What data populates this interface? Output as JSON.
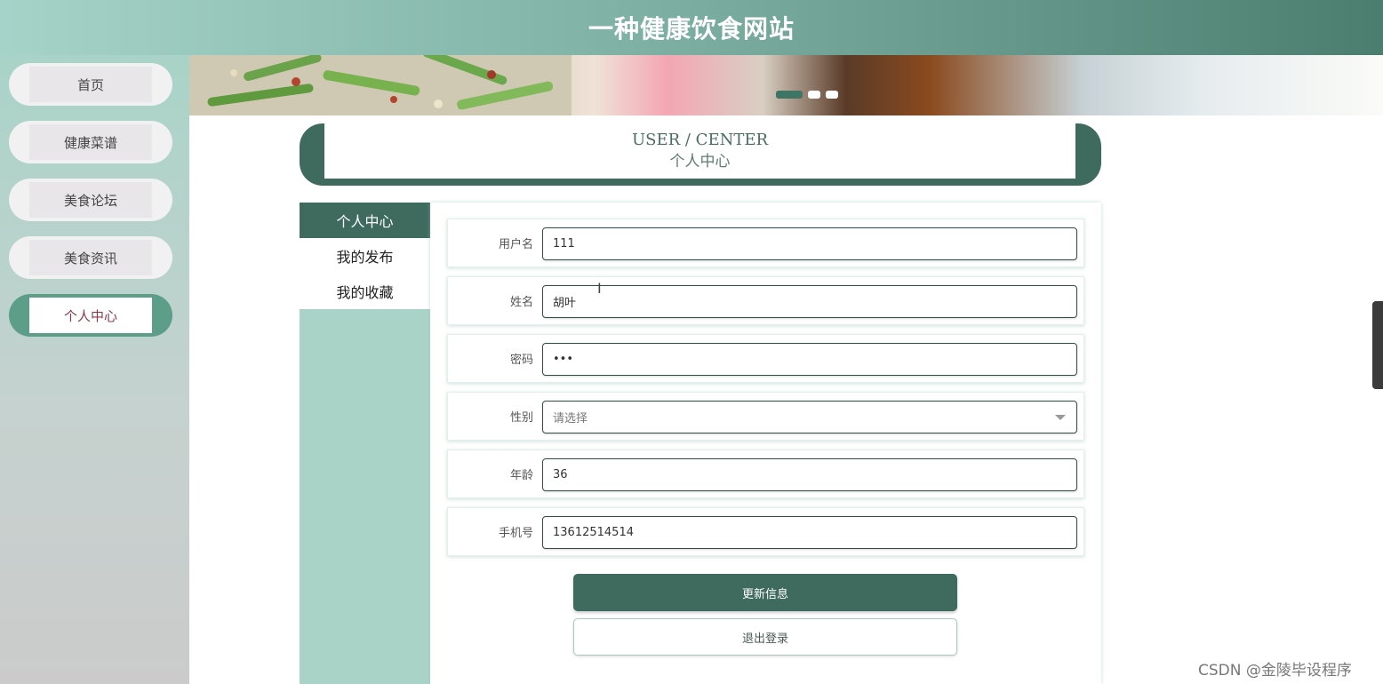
{
  "header": {
    "title": "一种健康饮食网站"
  },
  "sidebar": {
    "items": [
      {
        "label": "首页",
        "active": false
      },
      {
        "label": "健康菜谱",
        "active": false
      },
      {
        "label": "美食论坛",
        "active": false
      },
      {
        "label": "美食资讯",
        "active": false
      },
      {
        "label": "个人中心",
        "active": true
      }
    ]
  },
  "banner": {
    "slide_count": 3,
    "active_slide": 1
  },
  "page_title": {
    "en": "USER / CENTER",
    "cn": "个人中心"
  },
  "menu": {
    "items": [
      {
        "label": "个人中心",
        "active": true
      },
      {
        "label": "我的发布",
        "active": false
      },
      {
        "label": "我的收藏",
        "active": false
      }
    ]
  },
  "form": {
    "username": {
      "label": "用户名",
      "value": "111"
    },
    "name": {
      "label": "姓名",
      "value": "胡叶"
    },
    "password": {
      "label": "密码",
      "value": "•••"
    },
    "gender": {
      "label": "性别",
      "placeholder": "请选择"
    },
    "age": {
      "label": "年龄",
      "value": "36"
    },
    "phone": {
      "label": "手机号",
      "value": "13612514514"
    },
    "update_button": "更新信息",
    "logout_button": "退出登录"
  },
  "watermark": "CSDN @金陵毕设程序",
  "colors": {
    "primary": "#3e6b5e",
    "accent_light": "#aad3c7",
    "active_nav_text": "#8b3a4a"
  }
}
